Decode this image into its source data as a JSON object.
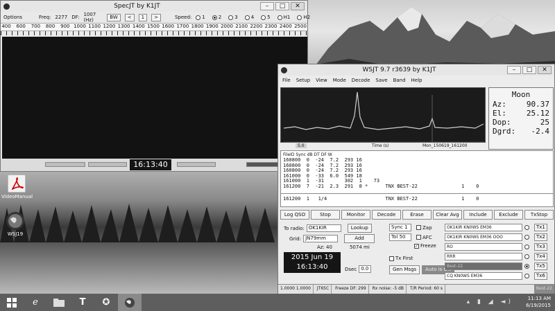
{
  "desktop": {
    "icons": [
      {
        "label": "VideoManual"
      },
      {
        "label": "WSJ19"
      }
    ]
  },
  "specjt": {
    "title": "SpecJT    by K1JT",
    "options": "Options",
    "freq_label": "Freq:",
    "freq_value": "2277",
    "df_label": "DF:",
    "df_value": "1007 (Hz)",
    "bw": "BW",
    "nav_left": "<",
    "nav_mid": "1",
    "nav_right": ">",
    "speed_label": "Speed:",
    "speeds": [
      "1",
      "2",
      "3",
      "4",
      "5",
      "H1",
      "H2"
    ],
    "ruler": [
      "400",
      "600",
      "700",
      "800",
      "900",
      "1000",
      "1100",
      "1200",
      "1300",
      "1400",
      "1500",
      "1600",
      "1700",
      "1800",
      "1900",
      "2000",
      "2100",
      "2200",
      "2300",
      "2400",
      "2500"
    ],
    "clock": "16:13:40"
  },
  "wsjt": {
    "title": "WSJT 9.7    r3639    by K1JT",
    "menu": [
      "File",
      "Setup",
      "View",
      "Mode",
      "Decode",
      "Save",
      "Band",
      "Help"
    ],
    "plot_footer": {
      "left": "5.0",
      "mid": "Time (s)",
      "right": "Mon_150619_161200"
    },
    "moon": {
      "title": "Moon",
      "az_label": "Az:",
      "az": "90.37",
      "el_label": "El:",
      "el": "25.12",
      "dop_label": "Dop:",
      "dop": "25",
      "dgrd_label": "Dgrd:",
      "dgrd": "-2.4"
    },
    "decode_header": "FileID    Sync   dB     DT    DF   W",
    "decode_lines": [
      "160800  0  -24  7.2  293 16",
      "160800  0  -24  7.2  293 16",
      "160800  0  -24  7.2  293 16",
      "161000  0  -33  6.0  549 18",
      "161000  1  -31       302  1    73",
      "161200  7  -21  2.3  291  8 *      TNX BEST-22               1    0"
    ],
    "decode2_line": "161200  1   1/4                    TNX BEST-22               1    0",
    "buttons": [
      "Log QSO",
      "Stop",
      "Monitor",
      "Decode",
      "Erase",
      "Clear Avg",
      "Include",
      "Exclude",
      "TxStop"
    ],
    "to_radio_label": "To radio:",
    "to_radio": "OK1KIR",
    "lookup": "Lookup",
    "grid_label": "Grid:",
    "grid": "JN79mm",
    "add": "Add",
    "az_line": "Az: 40",
    "dist": "5074 mi",
    "date": "2015 Jun 19",
    "time": "16:13:40",
    "sync_label": "Sync",
    "sync": "1",
    "tol_label": "Tol",
    "tol": "50",
    "zap": "Zap",
    "afc": "AFC",
    "freeze": "Freeze",
    "tx_first": "Tx First",
    "gen_msgs": "Gen Msgs",
    "auto": "Auto is ON",
    "dsec_label": "Dsec",
    "dsec": "0.0",
    "tx_messages": [
      {
        "text": "OK1KIR KN0WS EM36",
        "btn": "Tx1"
      },
      {
        "text": "OK1KIR KN0WS EM36 OOO",
        "btn": "Tx2"
      },
      {
        "text": "RO",
        "btn": "Tx3"
      },
      {
        "text": "RRR",
        "btn": "Tx4"
      },
      {
        "text": "Best-22",
        "btn": "Tx5"
      },
      {
        "text": "CQ KN0WS EM36",
        "btn": "Tx6"
      }
    ],
    "status": [
      "1.0000  1.0000",
      "JT65C",
      "Freeze DF: 299",
      "Rx noise: -5 dB",
      "T/R Period: 60 s"
    ],
    "status_right": "Best-22"
  },
  "taskbar": {
    "time": "11:13 AM",
    "date": "6/19/2015"
  },
  "colors": {
    "waterfall": "#121212",
    "clock_bg": "#151515",
    "taskbar": "#5e5e5e"
  }
}
